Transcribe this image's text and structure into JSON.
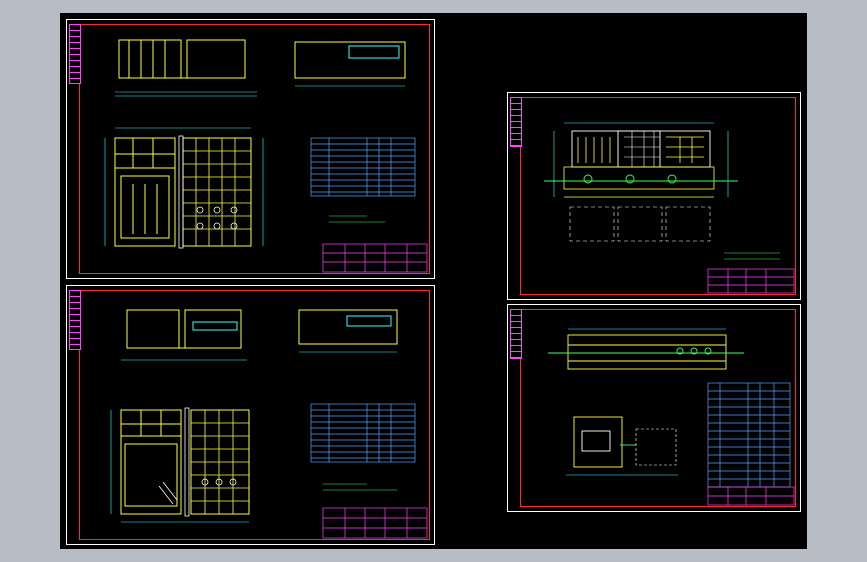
{
  "canvas": {
    "background": "#000000",
    "backdrop": "#b8bcc4"
  },
  "colors": {
    "sheet_border": "#ffffff",
    "frame": "#ff2b2b",
    "structure": "#ffff33",
    "walls": "#ffffff",
    "dimension": "#33ffff",
    "tables": "#4da6ff",
    "titleblock": "#ff40ff",
    "pipes": "#33ff66"
  },
  "sheets": [
    {
      "id": "sheet-top-left",
      "kind": "filter-plan"
    },
    {
      "id": "sheet-bottom-left",
      "kind": "filter-plan"
    },
    {
      "id": "sheet-top-right",
      "kind": "pump-elevation"
    },
    {
      "id": "sheet-bottom-right",
      "kind": "pipe-gallery"
    }
  ]
}
